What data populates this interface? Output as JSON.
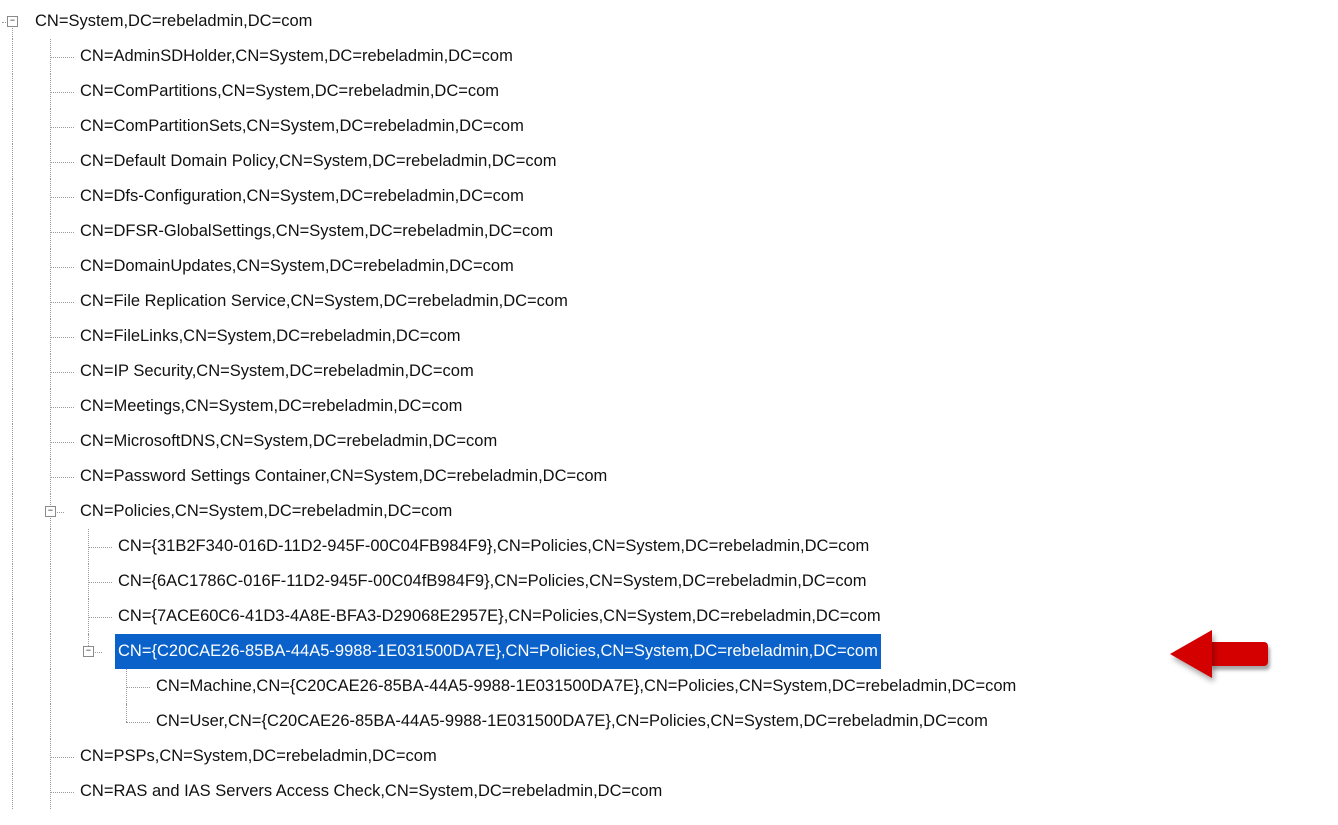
{
  "glyph": {
    "minus": "−",
    "plus": "+"
  },
  "tree": {
    "root": "CN=System,DC=rebeladmin,DC=com",
    "children": [
      "CN=AdminSDHolder,CN=System,DC=rebeladmin,DC=com",
      "CN=ComPartitions,CN=System,DC=rebeladmin,DC=com",
      "CN=ComPartitionSets,CN=System,DC=rebeladmin,DC=com",
      "CN=Default Domain Policy,CN=System,DC=rebeladmin,DC=com",
      "CN=Dfs-Configuration,CN=System,DC=rebeladmin,DC=com",
      "CN=DFSR-GlobalSettings,CN=System,DC=rebeladmin,DC=com",
      "CN=DomainUpdates,CN=System,DC=rebeladmin,DC=com",
      "CN=File Replication Service,CN=System,DC=rebeladmin,DC=com",
      "CN=FileLinks,CN=System,DC=rebeladmin,DC=com",
      "CN=IP Security,CN=System,DC=rebeladmin,DC=com",
      "CN=Meetings,CN=System,DC=rebeladmin,DC=com",
      "CN=MicrosoftDNS,CN=System,DC=rebeladmin,DC=com",
      "CN=Password Settings Container,CN=System,DC=rebeladmin,DC=com"
    ],
    "policies": {
      "label": "CN=Policies,CN=System,DC=rebeladmin,DC=com",
      "children": [
        "CN={31B2F340-016D-11D2-945F-00C04FB984F9},CN=Policies,CN=System,DC=rebeladmin,DC=com",
        "CN={6AC1786C-016F-11D2-945F-00C04fB984F9},CN=Policies,CN=System,DC=rebeladmin,DC=com",
        "CN={7ACE60C6-41D3-4A8E-BFA3-D29068E2957E},CN=Policies,CN=System,DC=rebeladmin,DC=com"
      ],
      "selected": {
        "label": "CN={C20CAE26-85BA-44A5-9988-1E031500DA7E},CN=Policies,CN=System,DC=rebeladmin,DC=com",
        "children": [
          "CN=Machine,CN={C20CAE26-85BA-44A5-9988-1E031500DA7E},CN=Policies,CN=System,DC=rebeladmin,DC=com",
          "CN=User,CN={C20CAE26-85BA-44A5-9988-1E031500DA7E},CN=Policies,CN=System,DC=rebeladmin,DC=com"
        ]
      }
    },
    "after": [
      "CN=PSPs,CN=System,DC=rebeladmin,DC=com",
      "CN=RAS and IAS Servers Access Check,CN=System,DC=rebeladmin,DC=com"
    ]
  }
}
